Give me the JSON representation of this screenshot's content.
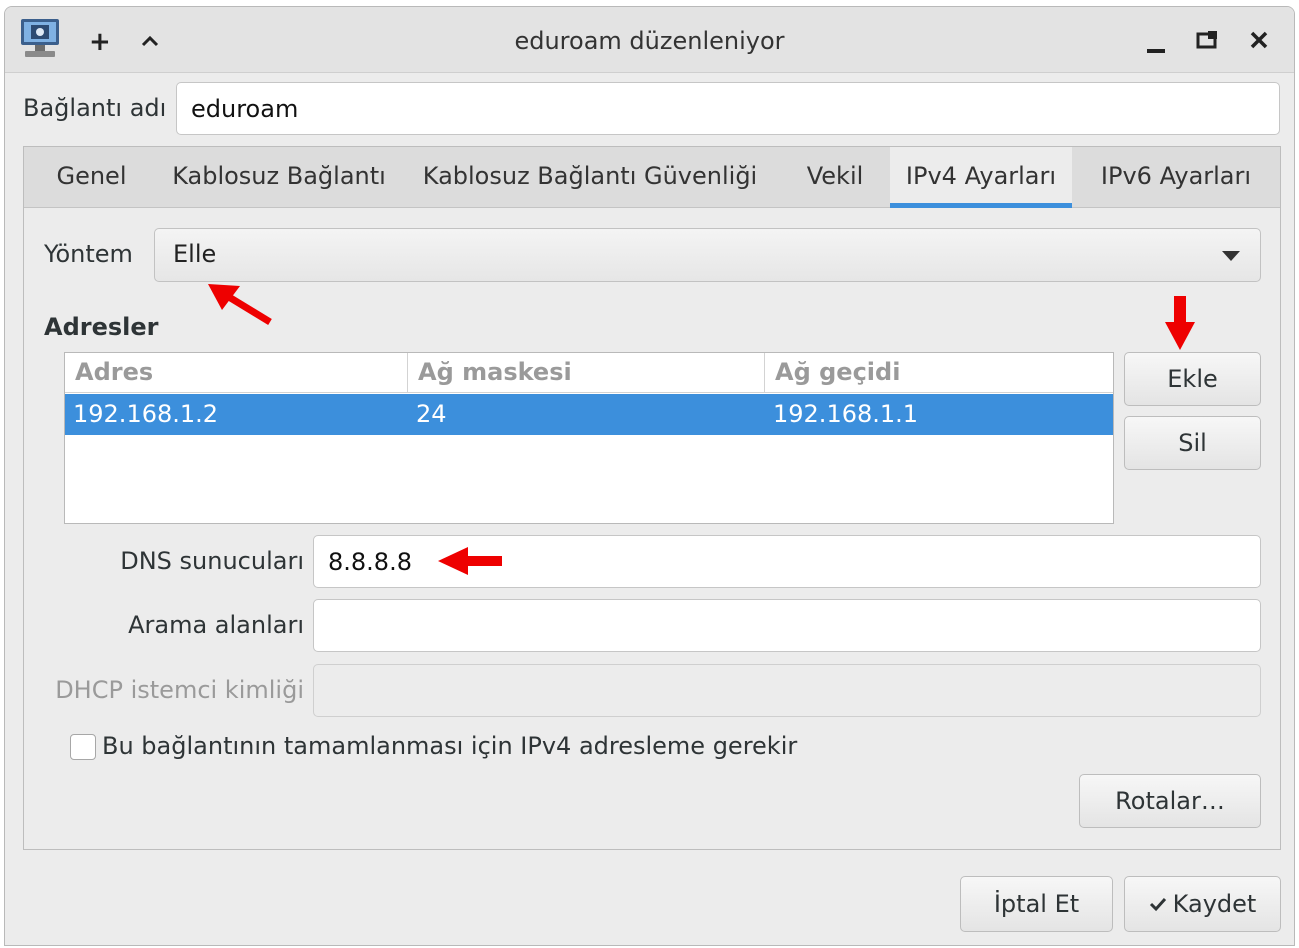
{
  "window": {
    "title": "eduroam düzenleniyor",
    "titlebar_buttons": {
      "pin": "+",
      "keep_above": "^",
      "minimize": "_",
      "maximize": "□",
      "close": "✕"
    }
  },
  "connection_name": {
    "label": "Bağlantı adı",
    "value": "eduroam"
  },
  "tabs": [
    {
      "label": "Genel",
      "active": false
    },
    {
      "label": "Kablosuz Bağlantı",
      "active": false
    },
    {
      "label": "Kablosuz Bağlantı Güvenliği",
      "active": false
    },
    {
      "label": "Vekil",
      "active": false
    },
    {
      "label": "IPv4 Ayarları",
      "active": true
    },
    {
      "label": "IPv6 Ayarları",
      "active": false
    }
  ],
  "method": {
    "label": "Yöntem",
    "value": "Elle"
  },
  "addresses": {
    "heading": "Adresler",
    "columns": [
      "Adres",
      "Ağ maskesi",
      "Ağ geçidi"
    ],
    "rows": [
      {
        "address": "192.168.1.2",
        "netmask": "24",
        "gateway": "192.168.1.1",
        "selected": true
      }
    ],
    "add_label": "Ekle",
    "delete_label": "Sil"
  },
  "dns": {
    "label": "DNS sunucuları",
    "value": "8.8.8.8"
  },
  "search_domains": {
    "label": "Arama alanları",
    "value": ""
  },
  "dhcp_client_id": {
    "label": "DHCP istemci kimliği",
    "value": "",
    "enabled": false
  },
  "require_ipv4": {
    "label": "Bu bağlantının tamamlanması için IPv4 adresleme gerekir",
    "checked": false
  },
  "routes_label": "Rotalar…",
  "footer": {
    "cancel_label": "İptal Et",
    "save_label": "Kaydet",
    "save_icon": "checkmark-icon"
  },
  "colors": {
    "accent": "#3c8fdc",
    "annotation_arrow": "#ee0000"
  }
}
